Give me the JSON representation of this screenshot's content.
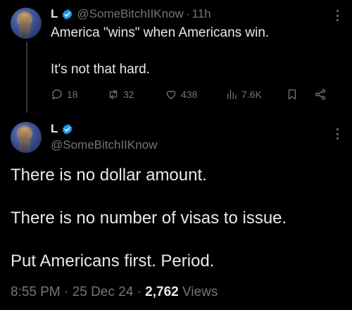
{
  "parent_tweet": {
    "display_name": "L",
    "handle": "@SomeBitchIIKnow",
    "separator": "·",
    "time": "11h",
    "text_lines": [
      "America \"wins\" when Americans win.",
      "It's not that hard."
    ],
    "stats": {
      "replies": "18",
      "reposts": "32",
      "likes": "438",
      "views": "7.6K"
    }
  },
  "main_tweet": {
    "display_name": "L",
    "handle": "@SomeBitchIIKnow",
    "paragraphs": [
      "There is no dollar amount.",
      "There is no number of visas to issue.",
      "Put Americans first. Period."
    ],
    "timestamp": "8:55 PM",
    "date": "25 Dec 24",
    "separator": "·",
    "views_count": "2,762",
    "views_label": "Views"
  },
  "icons": {
    "verified": "verified-badge-icon",
    "reply": "reply-icon",
    "repost": "repost-icon",
    "like": "heart-icon",
    "views": "bar-chart-icon",
    "bookmark": "bookmark-icon",
    "share": "share-icon",
    "more": "more-icon"
  },
  "colors": {
    "background": "#000000",
    "text_primary": "#e7e9ea",
    "text_secondary": "#71767b",
    "verified_blue": "#1d9bf0",
    "thread_line": "#333639"
  }
}
